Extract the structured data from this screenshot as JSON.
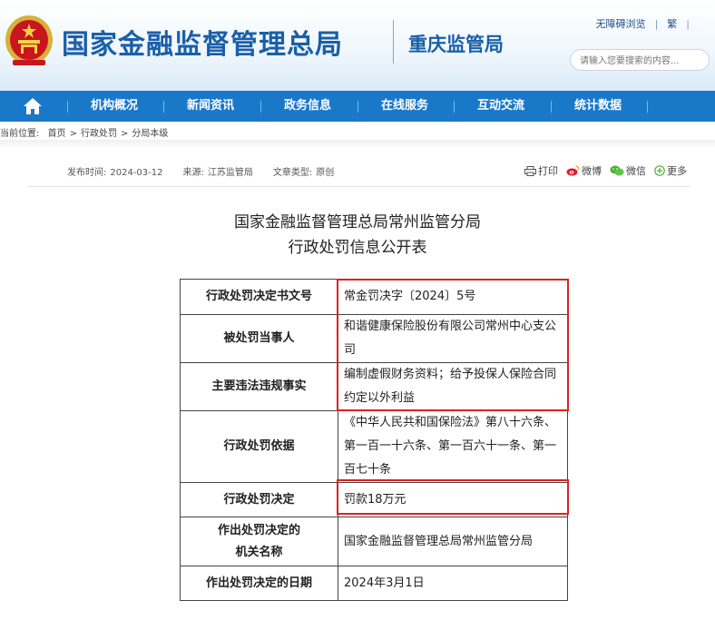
{
  "header": {
    "site_title": "国家金融监督管理总局",
    "sub_site": "重庆监管局",
    "top_links": [
      "无障碍浏览",
      "繁"
    ],
    "search": {
      "placeholder": "请输入您要搜索的内容..."
    },
    "emblem_icon": "national-emblem-icon"
  },
  "nav": {
    "home_icon": "home-icon",
    "items": [
      "机构概况",
      "新闻资讯",
      "政务信息",
      "在线服务",
      "互动交流",
      "统计数据"
    ]
  },
  "breadcrumb": {
    "prefix": "当前位置:",
    "items": [
      "首页",
      "行政处罚",
      "分局本级"
    ]
  },
  "meta": {
    "publish_label": "发布时间:",
    "publish_date": "2024-03-12",
    "source_label": "来源:",
    "source": "江苏监管局",
    "type_label": "文章类型:",
    "type": "原创"
  },
  "share": {
    "print": "打印",
    "weibo": "微博",
    "wechat": "微信",
    "more": "更多"
  },
  "document": {
    "title_line1": "国家金融监督管理总局常州监管分局",
    "title_line2": "行政处罚信息公开表",
    "rows": [
      {
        "key": "行政处罚决定书文号",
        "value": "常金罚决字〔2024〕5号"
      },
      {
        "key": "被处罚当事人",
        "value": "和谐健康保险股份有限公司常州中心支公司"
      },
      {
        "key": "主要违法违规事实",
        "value": "编制虚假财务资料；给予投保人保险合同约定以外利益"
      },
      {
        "key": "行政处罚依据",
        "value": "《中华人民共和国保险法》第八十六条、第一百一十六条、第一百六十一条、第一百七十条"
      },
      {
        "key": "行政处罚决定",
        "value": "罚款18万元"
      },
      {
        "key_line1": "作出处罚决定的",
        "key_line2": "机关名称",
        "value": "国家金融监督管理总局常州监管分局"
      },
      {
        "key": "作出处罚决定的日期",
        "value": "2024年3月1日"
      }
    ]
  },
  "colors": {
    "brand_blue": "#1a5fa8",
    "nav_blue": "#1a78c9",
    "highlight_red": "#e02020"
  }
}
